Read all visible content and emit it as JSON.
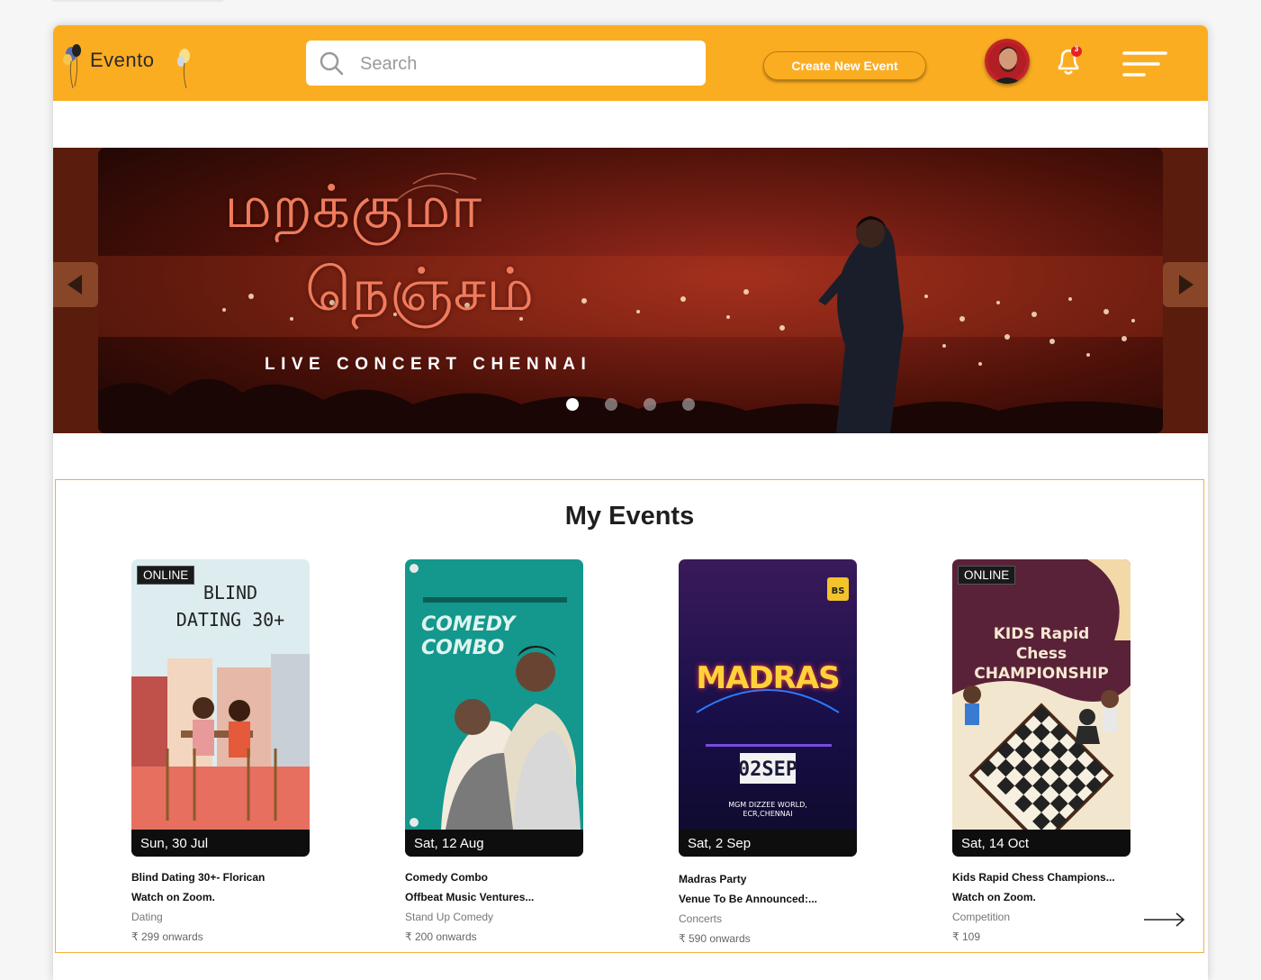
{
  "header": {
    "logo_text": "Evento",
    "search_placeholder": "Search",
    "create_button": "Create New Event",
    "notification_count": "3",
    "accent_color": "#fbad22"
  },
  "banner": {
    "title_tamil_line1": "மறக்குமா",
    "title_tamil_line2": "நெஞ்சம்",
    "subtitle": "LIVE CONCERT CHENNAI",
    "slide_count": 4,
    "active_slide": 1
  },
  "my_events": {
    "heading": "My Events",
    "cards": [
      {
        "badge": "ONLINE",
        "poster_text": "BLIND DATING 30+",
        "date": "Sun, 30 Jul",
        "title": "Blind Dating 30+- Florican",
        "venue": "Watch on Zoom.",
        "category": "Dating",
        "price": "₹ 299 onwards"
      },
      {
        "badge": "",
        "poster_text": "COMEDY COMBO",
        "date": "Sat, 12 Aug",
        "title": "Comedy Combo",
        "venue": "Offbeat Music Ventures...",
        "category": "Stand Up Comedy",
        "price": "₹ 200 onwards"
      },
      {
        "badge": "",
        "poster_text": "MADRAS",
        "date": "Sat, 2 Sep",
        "title": "Madras Party",
        "venue": "Venue To Be Announced:...",
        "category": "Concerts",
        "price": "₹ 590 onwards"
      },
      {
        "badge": "ONLINE",
        "poster_text": "KIDS Rapid Chess CHAMPIONSHIP",
        "date": "Sat, 14 Oct",
        "title": "Kids Rapid Chess Champions...",
        "venue": "Watch on Zoom.",
        "category": "Competition",
        "price": "₹ 109"
      }
    ]
  },
  "icons": [
    "search-icon",
    "bell-icon",
    "menu-icon",
    "chevron-left-icon",
    "chevron-right-icon",
    "arrow-right-icon"
  ]
}
